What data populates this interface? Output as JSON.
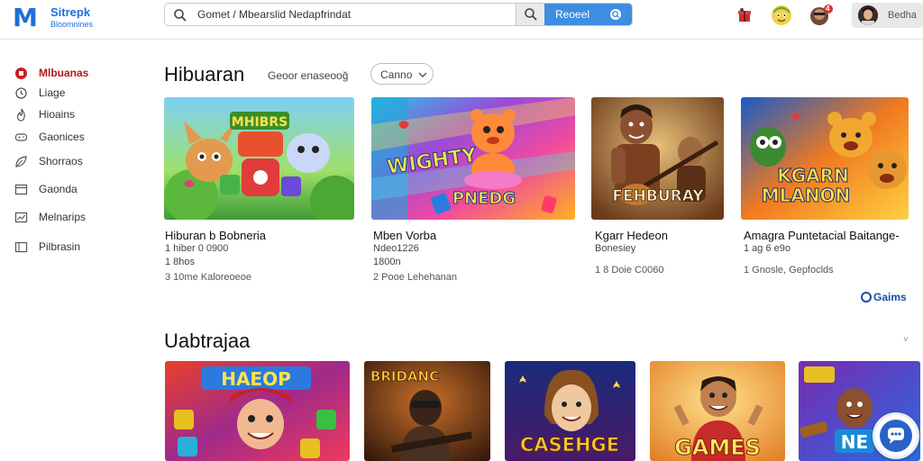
{
  "header": {
    "logo_mark": "M",
    "logo_name": "Sitrepk",
    "logo_sub": "Bloomnines",
    "search_value": "Gomet / Mbearslid Nedapfrindat",
    "search_placeholder": "Search",
    "search_go_label": "Reoeel",
    "profile_label": "Bedha",
    "notification_count": "4"
  },
  "sidebar": {
    "items": [
      {
        "label": "Mlbuanas",
        "icon": "home-icon",
        "active": true
      },
      {
        "label": "Liage",
        "icon": "clock-icon"
      },
      {
        "label": "Hioains",
        "icon": "flame-icon"
      },
      {
        "label": "Gaonices",
        "icon": "gamepad-icon"
      },
      {
        "label": "Shorraos",
        "icon": "leaf-icon"
      },
      {
        "label": "Gaonda",
        "icon": "window-icon"
      },
      {
        "label": "Melnarips",
        "icon": "chart-icon"
      },
      {
        "label": "Pilbrasin",
        "icon": "library-icon"
      }
    ]
  },
  "section1": {
    "title": "Hibuaran",
    "sort_label": "Geoor enaseooğ",
    "filter_label": "Canno",
    "cards": [
      {
        "title": "Hiburan b Bobneria",
        "meta": "1 hiber 0 0900",
        "meta2": "1 8hos",
        "meta3": "3 10me Kaloreoeoe",
        "art": "MHIBRS"
      },
      {
        "title": "Mben Vorba",
        "meta": "Ndeo1226",
        "meta2": "1800n",
        "meta3": "2 Pooe Lehehanan",
        "art": "WIGHTY"
      },
      {
        "title": "Kgarr Hedeon",
        "meta": "Bonesiey",
        "meta2": "",
        "meta3": "1 8 Doie C0060",
        "art": "FEHBURAY"
      },
      {
        "title": "Amagra Puntetacial Baitange-",
        "meta": "1 ag 6 e9o",
        "meta2": "",
        "meta3": "1 Gnosle, Gepfoclds",
        "art": "KGARN MLANON"
      }
    ],
    "more_label": "Gaims"
  },
  "section2": {
    "title": "Uabtrajaa",
    "chevron": "˅",
    "cards": [
      {
        "art": "HAEOP"
      },
      {
        "art": "BRIDANC"
      },
      {
        "art": "CASEHGE"
      },
      {
        "art": "GAMES"
      },
      {
        "art": "NE"
      }
    ]
  }
}
